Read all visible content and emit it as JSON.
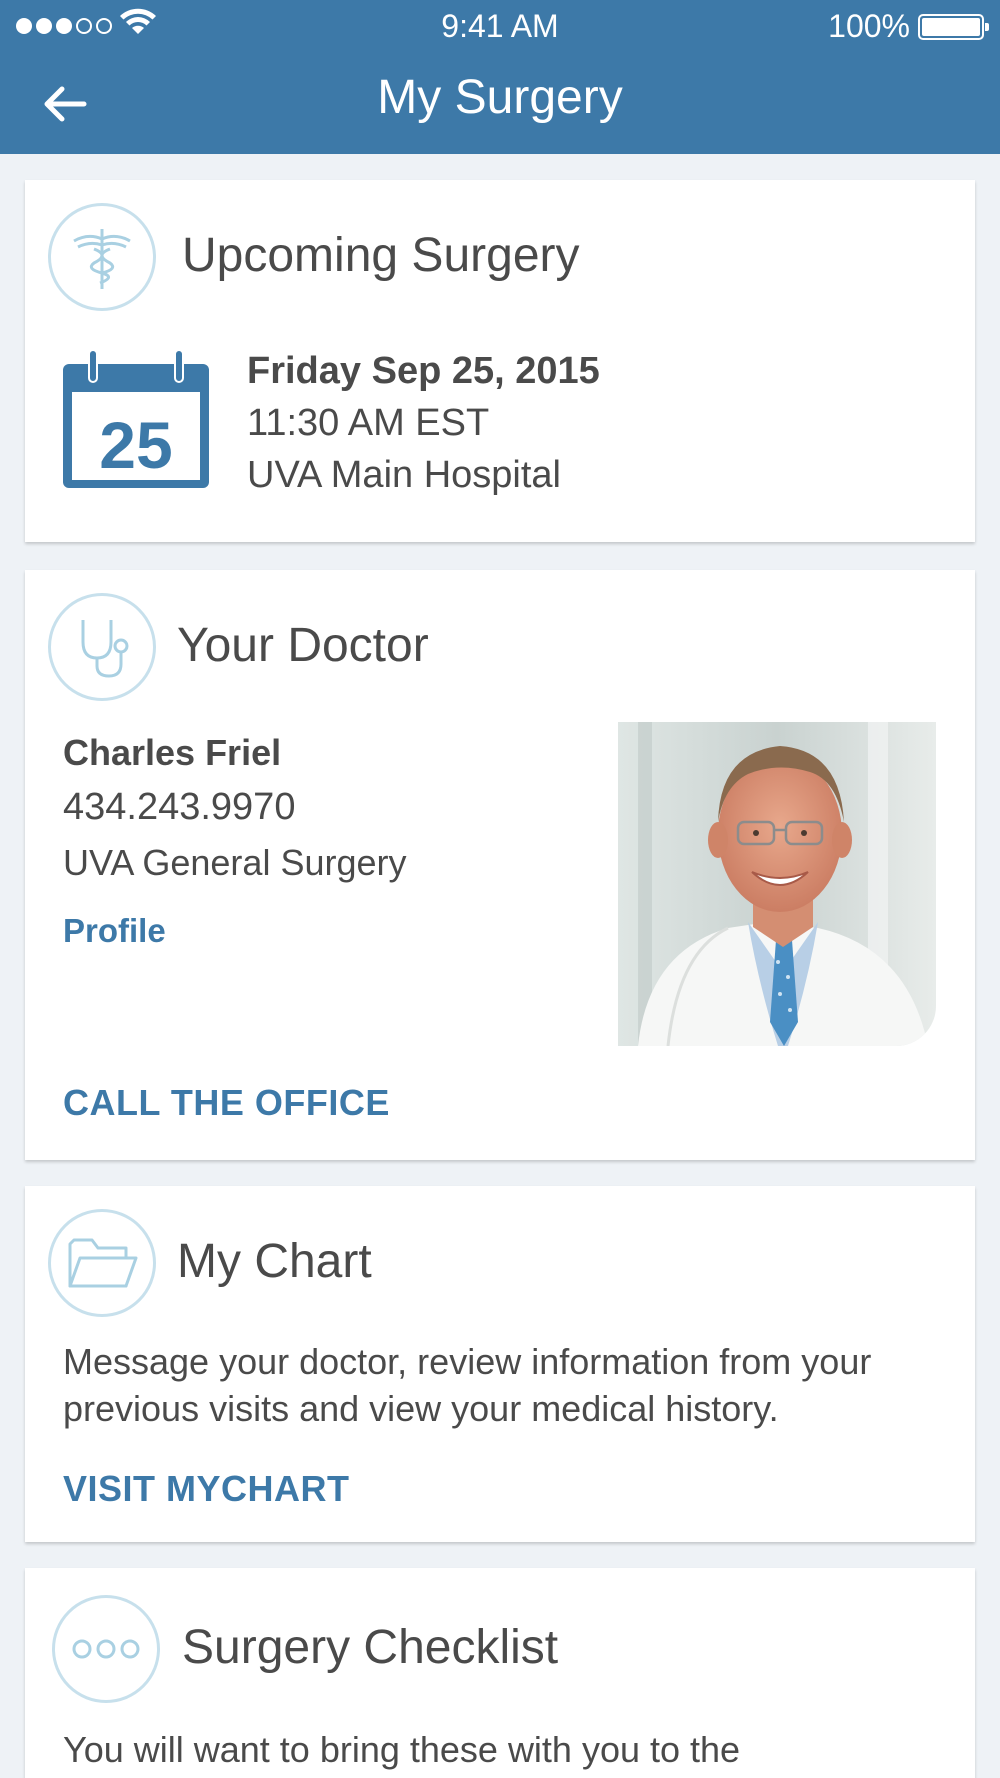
{
  "status_bar": {
    "time": "9:41 AM",
    "battery": "100%",
    "signal_bars": 3,
    "signal_total": 5
  },
  "nav": {
    "title": "My Surgery",
    "back_icon": "arrow-left-icon"
  },
  "upcoming": {
    "title": "Upcoming Surgery",
    "icon": "caduceus-icon",
    "calendar_day": "25",
    "date": "Friday Sep 25, 2015",
    "time": "11:30 AM EST",
    "location": "UVA Main Hospital"
  },
  "doctor": {
    "title": "Your Doctor",
    "icon": "stethoscope-icon",
    "name": "Charles Friel",
    "phone": "434.243.9970",
    "department": "UVA General Surgery",
    "profile_link": "Profile",
    "call_button": "CALL THE OFFICE"
  },
  "chart": {
    "title": "My Chart",
    "icon": "folder-icon",
    "description": "Message your doctor, review information from your previous visits and view your medical history.",
    "visit_button": "VISIT MYCHART"
  },
  "checklist": {
    "title": "Surgery Checklist",
    "icon": "more-dots-icon",
    "description": "You will want to bring these with you to the"
  },
  "colors": {
    "header": "#3d79a8",
    "accent": "#3d79a8",
    "icon_ring": "#c7e0ec",
    "background": "#eef2f6"
  }
}
